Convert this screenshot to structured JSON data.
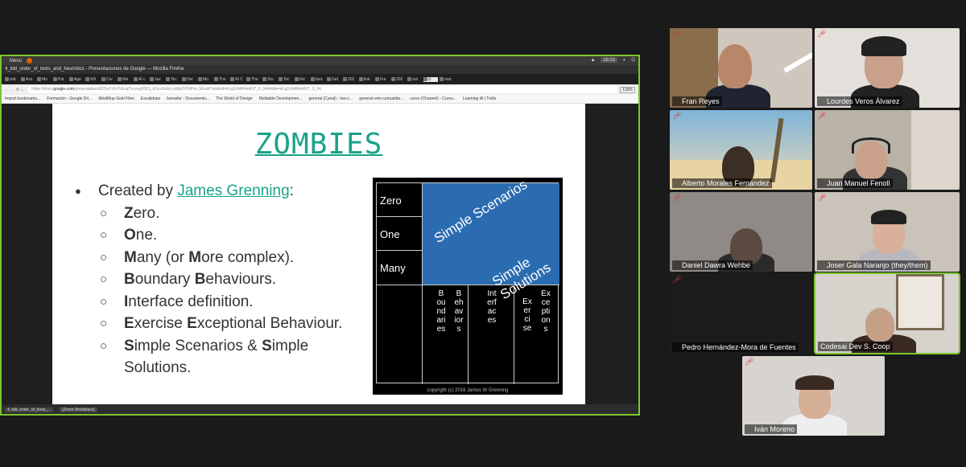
{
  "topbar": {
    "menu": "Menú",
    "clock": "28:52"
  },
  "window_title": "4_tdd_order_of_tests_and_heuristics - Presentaciones de Google — Mozilla Firefox",
  "tabs": [
    "slid",
    "Ass",
    "Mo",
    "Pat",
    "Age",
    "Wil",
    "Cor",
    "We",
    "AI c",
    "Jaz",
    "Tec",
    "Der",
    "Mo",
    "The",
    "AI C",
    "The",
    "Sto",
    "Tec",
    "the",
    "lanc",
    "Get",
    "202",
    "link",
    "Fre",
    "202",
    "out",
    "d",
    "mar"
  ],
  "url": {
    "prefix": "https://docs.",
    "domain": "google.com",
    "path": "/presentation/d/1SuYr3nTcEvqTxozeg9SDj_E0cs3mbLcyWpOCRPsn.SI/edit?slideId=id.g2c94f64d437_0_94#slide=id.g2c94f64d437_0_94",
    "zoom": "133%"
  },
  "bookmarks": [
    "Import bookmarks...",
    "Formación - Google Dri...",
    "MindMup Gold Files",
    "Excalidraw",
    "borrador - Documento...",
    "The World of Design",
    "Moldable Developmen...",
    "general (Canal) - tsw-c...",
    "general-cms-comunida...",
    "curso (Channel) - Curso...",
    "Learning IA | Trello"
  ],
  "slide": {
    "title": "ZOMBIES",
    "created_by_prefix": "Created by ",
    "created_by_link": "James Grenning",
    "created_by_suffix": ":",
    "items": [
      {
        "initial": "Z",
        "rest": "ero."
      },
      {
        "initial": "O",
        "rest": "ne."
      },
      {
        "initial": "M",
        "rest": "any (or ",
        "initial2": "M",
        "rest2": "ore complex)."
      },
      {
        "initial": "B",
        "rest": "oundary ",
        "initial2": "B",
        "rest2": "ehaviours."
      },
      {
        "initial": "I",
        "rest": "nterface definition."
      },
      {
        "initial": "E",
        "rest": "xercise ",
        "initial2": "E",
        "rest2": "xceptional Behaviour."
      },
      {
        "initial": "S",
        "rest": "imple Scenarios & ",
        "initial2": "S",
        "rest2": "imple"
      }
    ],
    "continuation": "Solutions.",
    "diagram": {
      "z": "Zero",
      "o": "One",
      "m": "Many",
      "simple_scenarios": "Simple Scenarios",
      "simple_solutions": "Simple Solutions",
      "boundaries": "Boundaries",
      "behaviors": "Behaviors",
      "interfaces": "Interfaces",
      "exercise": "Exercise",
      "exceptions": "Exceptions",
      "copyright": "copyright (c) 2016 James W Grenning"
    }
  },
  "taskbar": [
    "4_tdd_order_of_tests_...",
    "[Zoom Workplace]"
  ],
  "participants": [
    {
      "name": "Fran Reyes"
    },
    {
      "name": "Lourdes Veros Álvarez"
    },
    {
      "name": "Alberto Morales Fernández"
    },
    {
      "name": "Juan Manuel Fenoll"
    },
    {
      "name": "Daniel Dawra Wehbe"
    },
    {
      "name": "Joser Gala Naranjo (they/them)"
    },
    {
      "name": "Pedro Hernández-Mora de Fuentes"
    },
    {
      "name": "Codesai Dev S. Coop"
    },
    {
      "name": "Iván Moreno"
    }
  ],
  "colors": {
    "accent_green": "#7bc62d",
    "slide_teal": "#19a38a",
    "diagram_blue": "#2b6cb0",
    "mic_red": "#e03030"
  }
}
